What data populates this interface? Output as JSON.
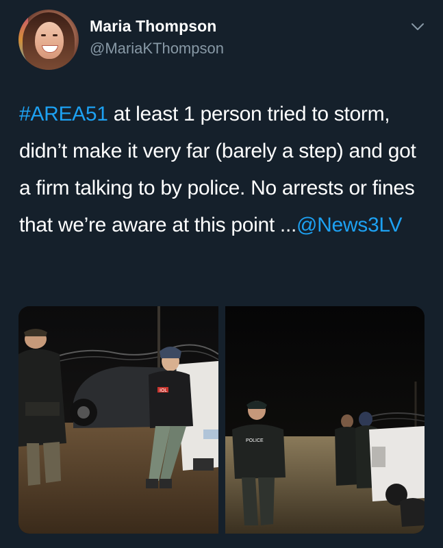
{
  "author": {
    "display_name": "Maria Thompson",
    "handle": "@MariaKThompson"
  },
  "tweet": {
    "hashtag": "#AREA51",
    "text_main": " at least 1 person tried to storm, didn’t make it very far (barely a step) and got a firm talking to by police. No arrests or fines that we’re aware at this point ...",
    "mention": "@News3LV"
  },
  "media": {
    "photo_left_labels": {
      "sweatshirt_text": "IOL"
    },
    "photo_right_labels": {
      "vest_text": "POLICE"
    }
  },
  "colors": {
    "background": "#15202b",
    "link": "#1da1f2",
    "secondary_text": "#8899a6"
  },
  "icons": {
    "more_options": "chevron-down-icon"
  }
}
